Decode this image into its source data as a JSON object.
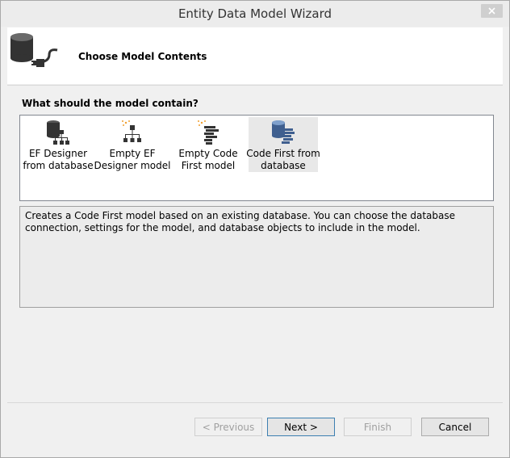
{
  "window": {
    "title": "Entity Data Model Wizard"
  },
  "header": {
    "title": "Choose Model Contents",
    "icon": "database-plug-icon"
  },
  "question": "What should the model contain?",
  "choices": [
    {
      "label": "EF Designer from database",
      "icon": "ef-designer-database-icon",
      "selected": false
    },
    {
      "label": "Empty EF Designer model",
      "icon": "empty-ef-designer-icon",
      "selected": false
    },
    {
      "label": "Empty Code First model",
      "icon": "empty-code-first-icon",
      "selected": false
    },
    {
      "label": "Code First from database",
      "icon": "code-first-database-icon",
      "selected": true
    }
  ],
  "description": "Creates a Code First model based on an existing database. You can choose the database connection, settings for the model, and database objects to include in the model.",
  "buttons": {
    "previous": "< Previous",
    "next": "Next >",
    "finish": "Finish",
    "cancel": "Cancel"
  },
  "colors": {
    "accent_blue": "#3c7fb1",
    "orange": "#f0a030",
    "icon_dark": "#333333",
    "db_blue": "#3f5f8f"
  }
}
